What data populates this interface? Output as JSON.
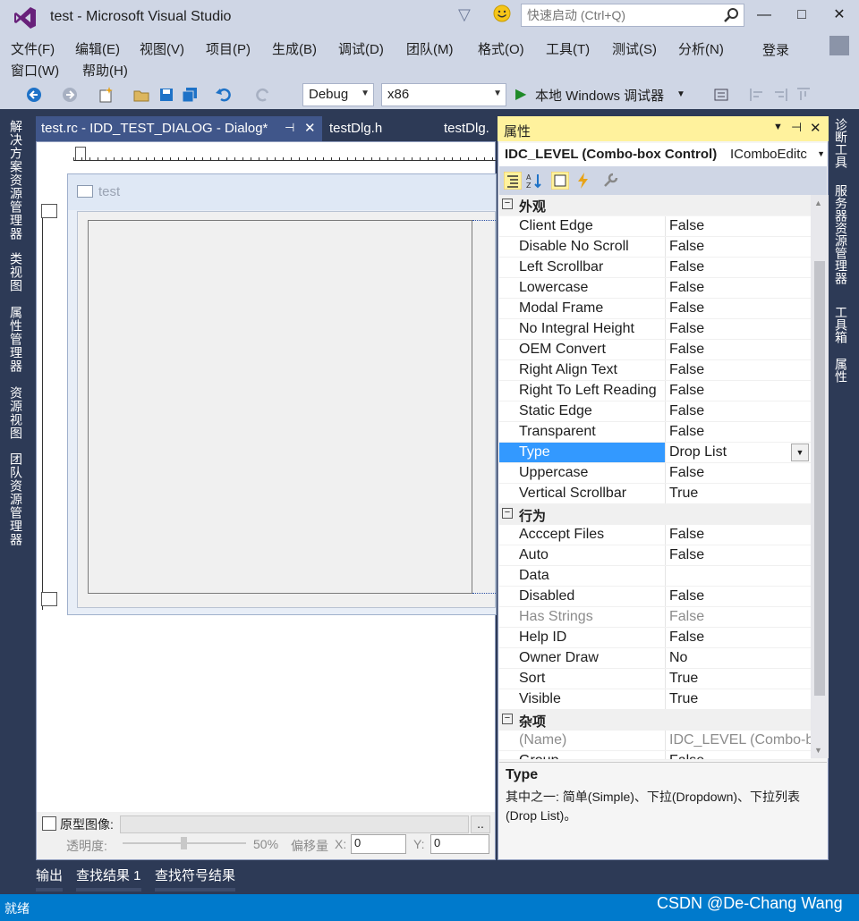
{
  "window": {
    "title": "test - Microsoft Visual Studio",
    "quick_launch_placeholder": "快速启动 (Ctrl+Q)",
    "minimize": "—",
    "maximize": "□",
    "close": "✕"
  },
  "menu": {
    "items": [
      "文件(F)",
      "编辑(E)",
      "视图(V)",
      "项目(P)",
      "生成(B)",
      "调试(D)",
      "团队(M)",
      "格式(O)",
      "工具(T)",
      "测试(S)",
      "分析(N)"
    ],
    "items_row2": [
      "窗口(W)",
      "帮助(H)"
    ],
    "login": "登录"
  },
  "toolbar": {
    "config": "Debug",
    "platform": "x86",
    "debugger": "本地 Windows 调试器"
  },
  "left_rail": [
    "解决方案资源管理器",
    "类视图",
    "属性管理器",
    "资源视图",
    "团队资源管理器"
  ],
  "right_rail": [
    "诊断工具",
    "服务器资源管理器",
    "工具箱",
    "属性"
  ],
  "tabs": {
    "active": "test.rc - IDD_TEST_DIALOG - Dialog*",
    "pin": "⊣",
    "close": "✕",
    "tab2": "testDlg.h",
    "tab3": "testDlg."
  },
  "dialog": {
    "title": "test"
  },
  "editor_bottom": {
    "prototype_label": "原型图像:",
    "browse": "..",
    "opacity_label": "透明度:",
    "opacity_value": "50%",
    "offset_label": "偏移量",
    "x_label": "X:",
    "x_value": "0",
    "y_label": "Y:",
    "y_value": "0"
  },
  "properties": {
    "panel_title": "属性",
    "object_name": "IDC_LEVEL (Combo-box Control)",
    "object_type": "IComboEditc",
    "categories": [
      {
        "name": "外观",
        "rows": [
          {
            "name": "Client Edge",
            "value": "False"
          },
          {
            "name": "Disable No Scroll",
            "value": "False"
          },
          {
            "name": "Left Scrollbar",
            "value": "False"
          },
          {
            "name": "Lowercase",
            "value": "False"
          },
          {
            "name": "Modal Frame",
            "value": "False"
          },
          {
            "name": "No Integral Height",
            "value": "False"
          },
          {
            "name": "OEM Convert",
            "value": "False"
          },
          {
            "name": "Right Align Text",
            "value": "False"
          },
          {
            "name": "Right To Left Reading",
            "value": "False"
          },
          {
            "name": "Static Edge",
            "value": "False"
          },
          {
            "name": "Transparent",
            "value": "False"
          },
          {
            "name": "Type",
            "value": "Drop List"
          },
          {
            "name": "Uppercase",
            "value": "False"
          },
          {
            "name": "Vertical Scrollbar",
            "value": "True"
          }
        ]
      },
      {
        "name": "行为",
        "rows": [
          {
            "name": "Acccept Files",
            "value": "False"
          },
          {
            "name": "Auto",
            "value": "False"
          },
          {
            "name": "Data",
            "value": ""
          },
          {
            "name": "Disabled",
            "value": "False"
          },
          {
            "name": "Has Strings",
            "value": "False"
          },
          {
            "name": "Help ID",
            "value": "False"
          },
          {
            "name": "Owner Draw",
            "value": "No"
          },
          {
            "name": "Sort",
            "value": "True"
          },
          {
            "name": "Visible",
            "value": "True"
          }
        ]
      },
      {
        "name": "杂项",
        "rows": [
          {
            "name": "(Name)",
            "value": "IDC_LEVEL (Combo-bo"
          },
          {
            "name": "Group",
            "value": "False"
          }
        ]
      }
    ],
    "desc_title": "Type",
    "desc_text": "其中之一: 简单(Simple)、下拉(Dropdown)、下拉列表(Drop List)。"
  },
  "output_tabs": [
    "输出",
    "查找结果 1",
    "查找符号结果"
  ],
  "status": "就绪",
  "watermark": "CSDN @De-Chang Wang"
}
